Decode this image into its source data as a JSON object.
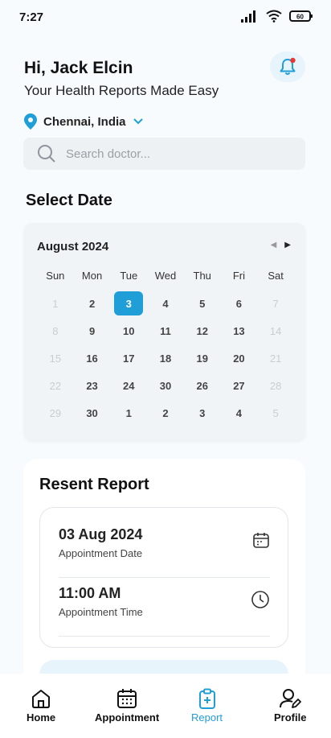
{
  "status_bar": {
    "time": "7:27",
    "battery": "60"
  },
  "header": {
    "greeting": "Hi, Jack Elcin",
    "subtitle": "Your Health Reports Made Easy"
  },
  "location": {
    "text": "Chennai, India"
  },
  "search": {
    "placeholder": "Search doctor..."
  },
  "calendar": {
    "section_title": "Select Date",
    "month_label": "August 2024",
    "weekdays": [
      "Sun",
      "Mon",
      "Tue",
      "Wed",
      "Thu",
      "Fri",
      "Sat"
    ],
    "selected_day": "3",
    "days": [
      {
        "d": "1",
        "m": true
      },
      {
        "d": "2"
      },
      {
        "d": "3",
        "s": true
      },
      {
        "d": "4"
      },
      {
        "d": "5"
      },
      {
        "d": "6"
      },
      {
        "d": "7",
        "m": true
      },
      {
        "d": "8",
        "m": true
      },
      {
        "d": "9"
      },
      {
        "d": "10"
      },
      {
        "d": "11"
      },
      {
        "d": "12"
      },
      {
        "d": "13"
      },
      {
        "d": "14",
        "m": true
      },
      {
        "d": "15",
        "m": true
      },
      {
        "d": "16"
      },
      {
        "d": "17"
      },
      {
        "d": "18"
      },
      {
        "d": "19"
      },
      {
        "d": "20"
      },
      {
        "d": "21",
        "m": true
      },
      {
        "d": "22",
        "m": true
      },
      {
        "d": "23"
      },
      {
        "d": "24"
      },
      {
        "d": "30"
      },
      {
        "d": "26"
      },
      {
        "d": "27"
      },
      {
        "d": "28",
        "m": true
      },
      {
        "d": "29",
        "m": true
      },
      {
        "d": "30"
      },
      {
        "d": "1"
      },
      {
        "d": "2"
      },
      {
        "d": "3"
      },
      {
        "d": "4"
      },
      {
        "d": "5",
        "m": true
      }
    ]
  },
  "report": {
    "title": "Resent Report",
    "date_value": "03 Aug 2024",
    "date_label": "Appointment Date",
    "time_value": "11:00 AM",
    "time_label": "Appointment Time"
  },
  "nav": {
    "home": "Home",
    "appointment": "Appointment",
    "report": "Report",
    "profile": "Profile"
  },
  "colors": {
    "accent": "#1f9ed8",
    "notification": "#e53935"
  }
}
